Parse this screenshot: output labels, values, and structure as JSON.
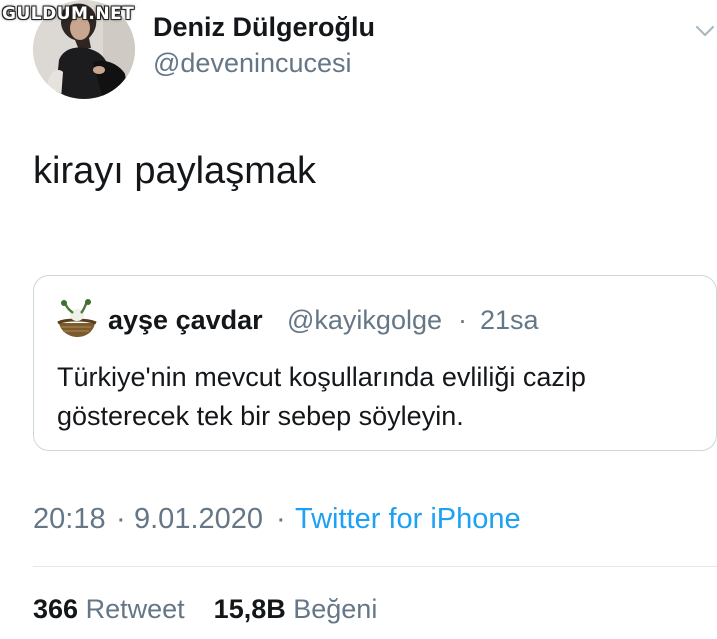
{
  "watermark": "GULDUM.NET",
  "author": {
    "display_name": "Deniz Dülgeroğlu",
    "handle": "@devenincucesi"
  },
  "tweet": {
    "text": "kirayı paylaşmak"
  },
  "quoted": {
    "display_name": "ayşe çavdar",
    "handle": "@kayikgolge",
    "separator": "·",
    "time": "21sa",
    "text": "Türkiye'nin mevcut koşullarında evliliği cazip gösterecek tek bir sebep söyleyin."
  },
  "meta": {
    "time": "20:18",
    "separator": "·",
    "date": "9.01.2020",
    "source": "Twitter for iPhone"
  },
  "stats": {
    "retweet_count": "366",
    "retweet_label": "Retweet",
    "like_count": "15,8B",
    "like_label": "Beğeni"
  },
  "icons": {
    "menu": "chevron-down-icon",
    "avatar": "profile-photo",
    "quoted_avatar": "bird-nest-avatar"
  },
  "colors": {
    "text": "#14171a",
    "secondary": "#657786",
    "link": "#1da1f2",
    "border": "#ccd6dd"
  }
}
